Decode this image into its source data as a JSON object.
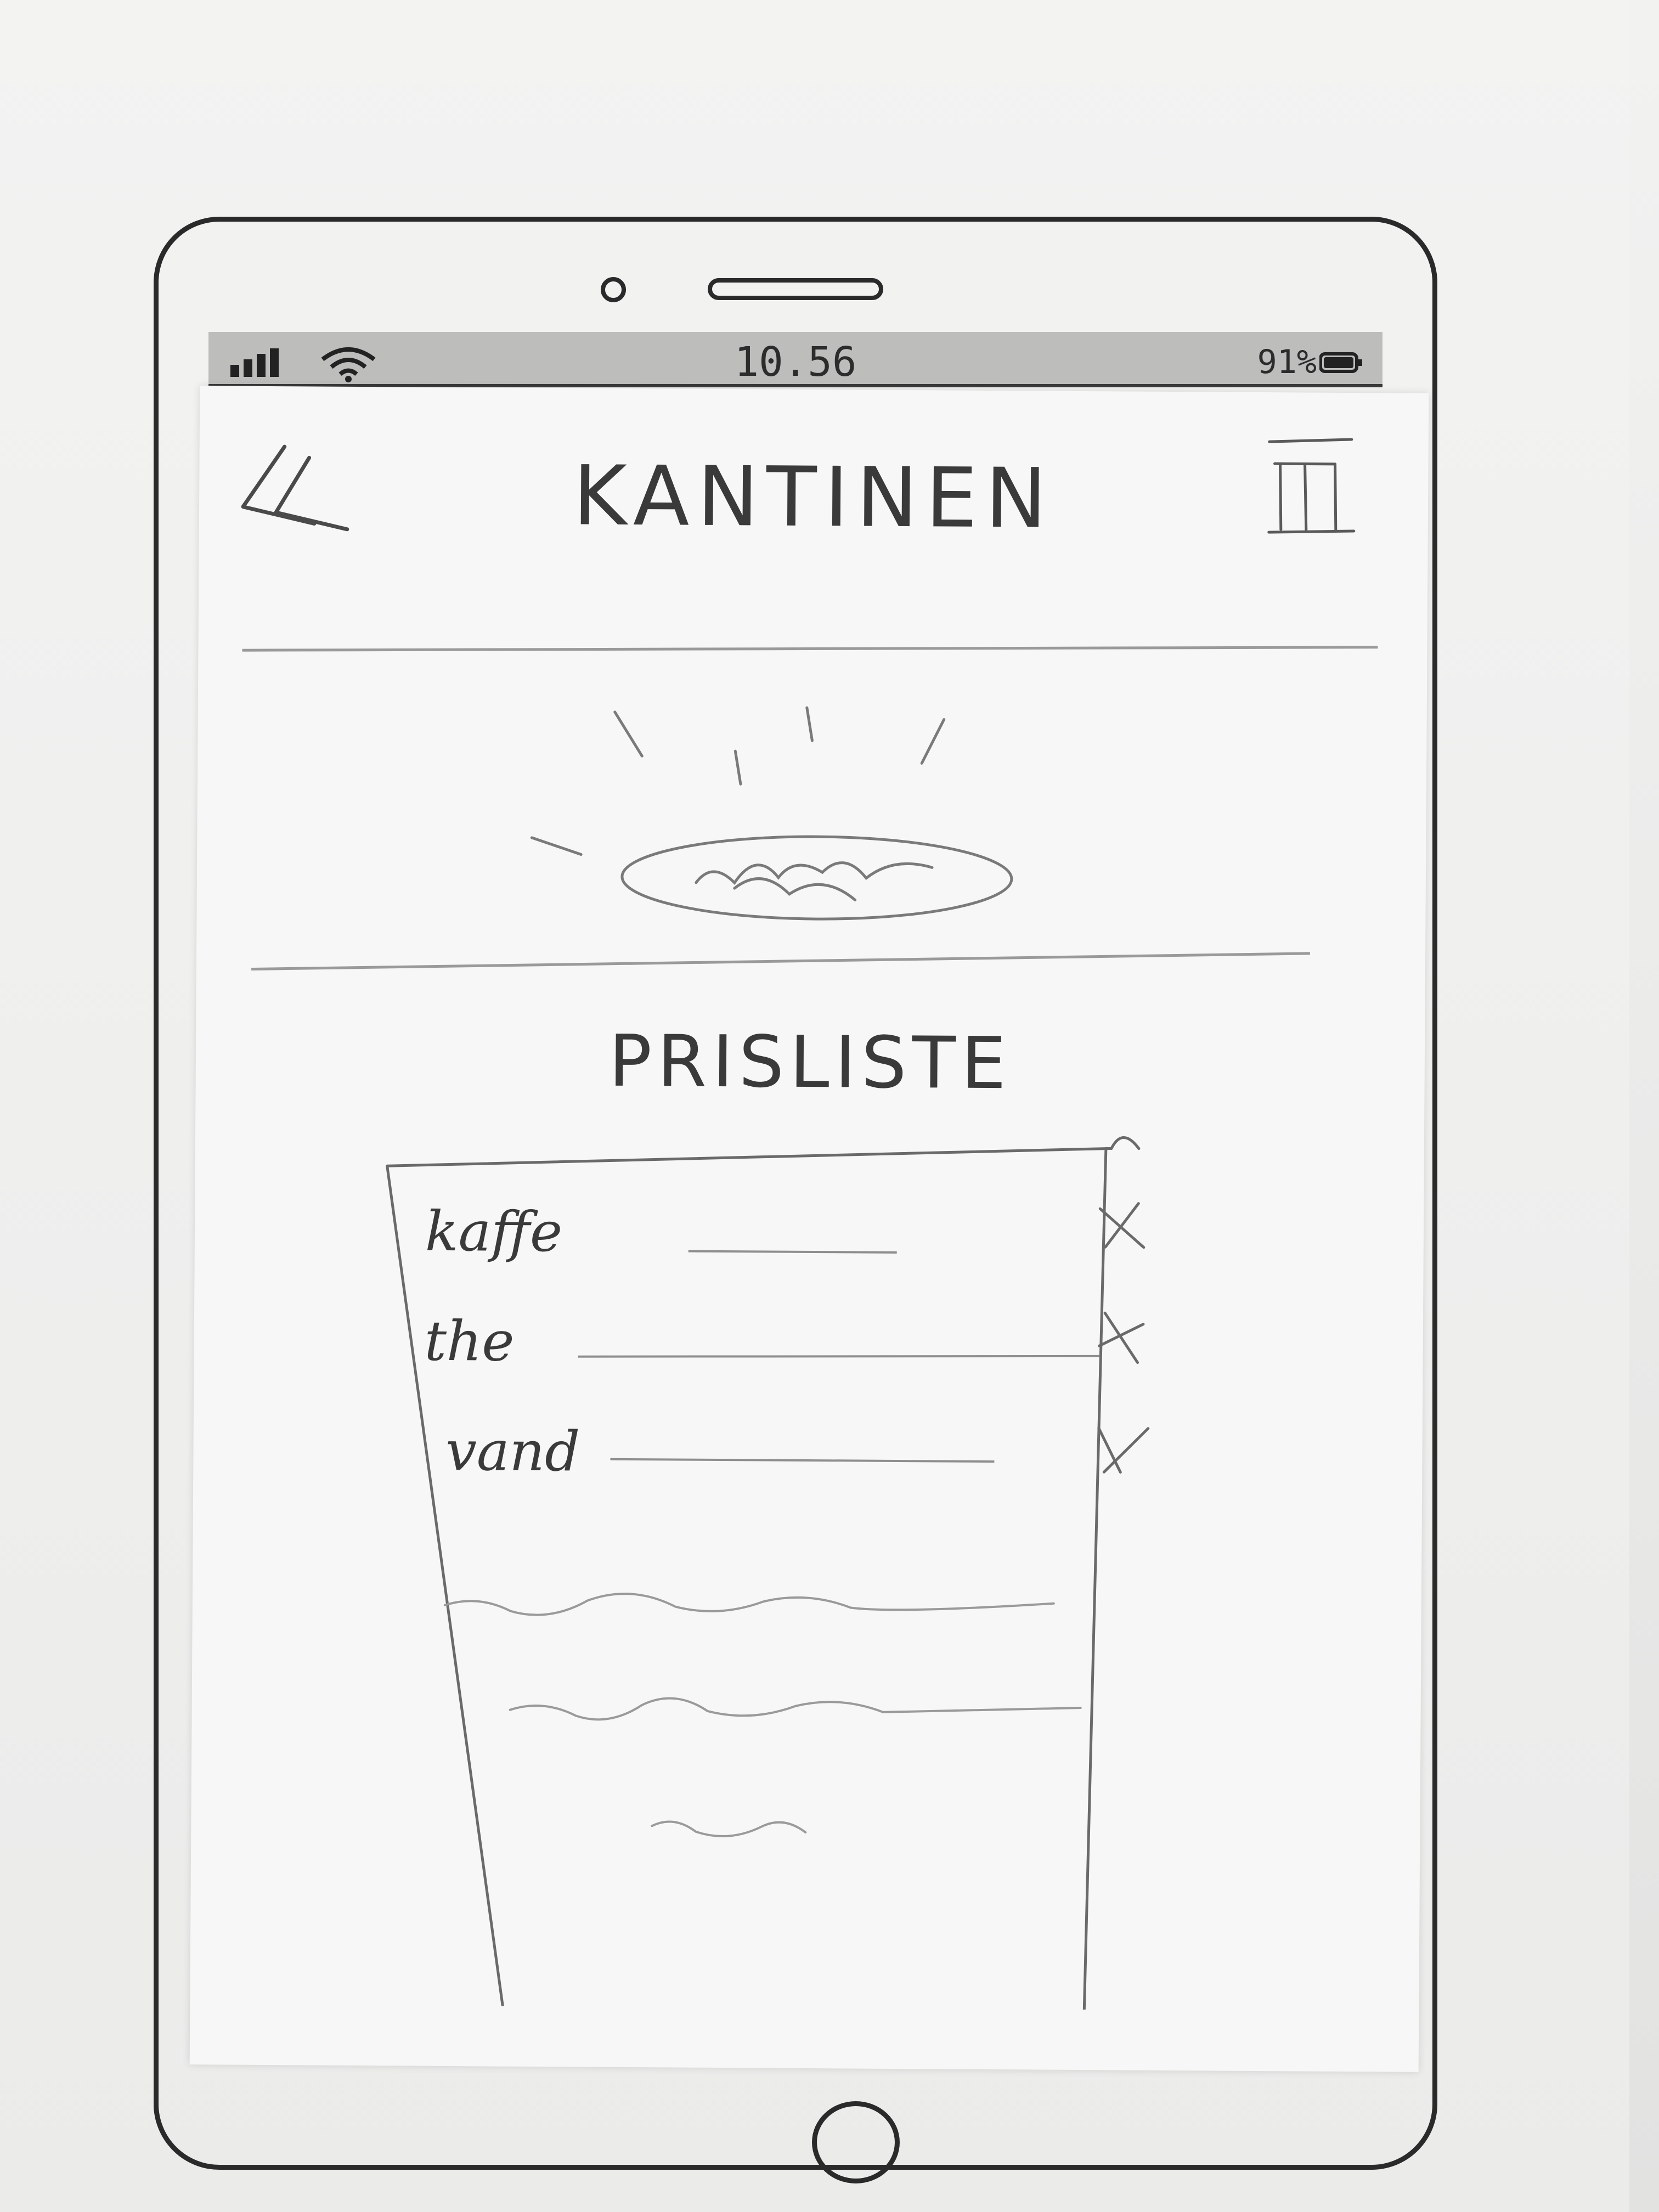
{
  "status_bar": {
    "time": "10.56",
    "battery": "91%"
  },
  "header": {
    "back_icon": "double-chevron-left-icon",
    "title": "KANTINEN",
    "menu_icon": "hamburger-menu-icon"
  },
  "hero": {
    "image": "food-plate-illustration"
  },
  "price_list": {
    "title": "PRISLISTE",
    "items": [
      {
        "name": "kaffe",
        "mark": "x"
      },
      {
        "name": "the",
        "mark": "x"
      },
      {
        "name": "vand",
        "mark": "x"
      }
    ]
  },
  "colors": {
    "ink": "#2a2a2a",
    "pencil": "#8e8e8e",
    "paper": "#f7f7f7"
  }
}
